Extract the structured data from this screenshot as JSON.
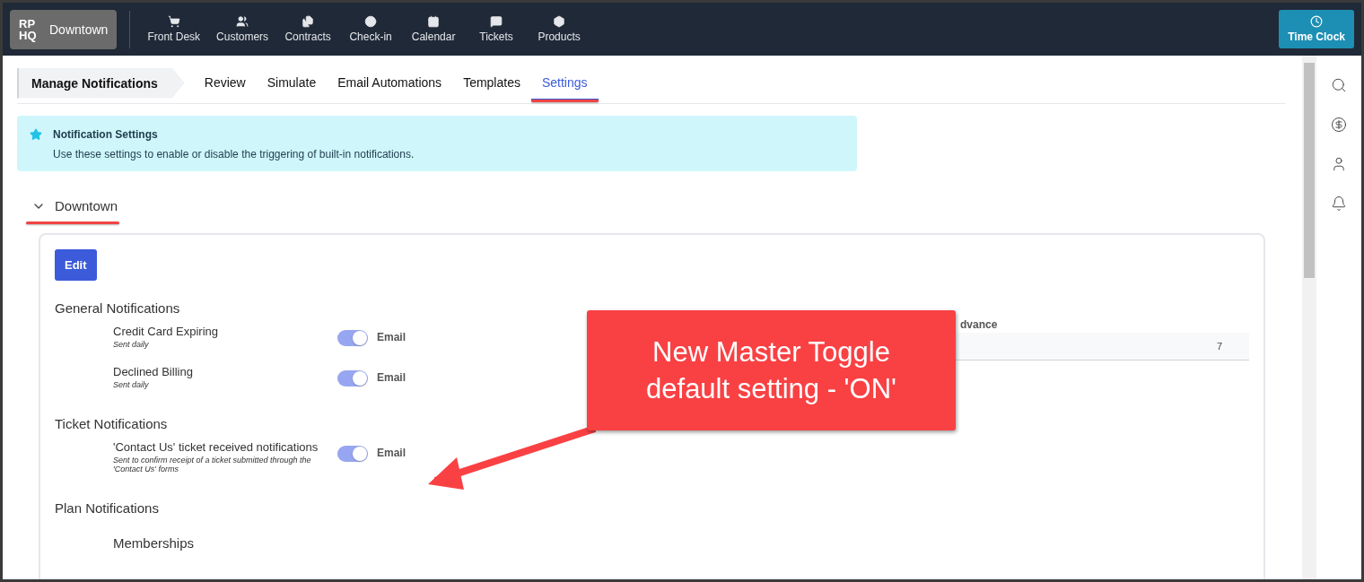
{
  "brand": {
    "logo": "RP HQ",
    "location": "Downtown"
  },
  "nav": [
    {
      "label": "Front Desk"
    },
    {
      "label": "Customers"
    },
    {
      "label": "Contracts"
    },
    {
      "label": "Check-in"
    },
    {
      "label": "Calendar"
    },
    {
      "label": "Tickets"
    },
    {
      "label": "Products"
    }
  ],
  "time_clock": "Time Clock",
  "breadcrumb": "Manage Notifications",
  "tabs": [
    {
      "label": "Review",
      "selected": false
    },
    {
      "label": "Simulate",
      "selected": false
    },
    {
      "label": "Email Automations",
      "selected": false
    },
    {
      "label": "Templates",
      "selected": false
    },
    {
      "label": "Settings",
      "selected": true
    }
  ],
  "info": {
    "title": "Notification Settings",
    "text": "Use these settings to enable or disable the triggering of built-in notifications."
  },
  "location_section": {
    "title": "Downtown",
    "expanded": true,
    "edit_button": "Edit",
    "side_field": {
      "label": "dvance",
      "value": "7"
    },
    "groups": [
      {
        "title": "General Notifications",
        "items": [
          {
            "name": "Credit Card Expiring",
            "note": "Sent daily",
            "channel": "Email",
            "on": true
          },
          {
            "name": "Declined Billing",
            "note": "Sent daily",
            "channel": "Email",
            "on": true
          }
        ]
      },
      {
        "title": "Ticket Notifications",
        "items": [
          {
            "name": "'Contact Us' ticket received notifications",
            "note": "Sent to confirm receipt of a ticket submitted through the 'Contact Us' forms",
            "channel": "Email",
            "on": true
          }
        ]
      },
      {
        "title": "Plan Notifications",
        "subheading": "Memberships"
      }
    ]
  },
  "callout": {
    "text": "New Master Toggle default setting - 'ON'"
  }
}
